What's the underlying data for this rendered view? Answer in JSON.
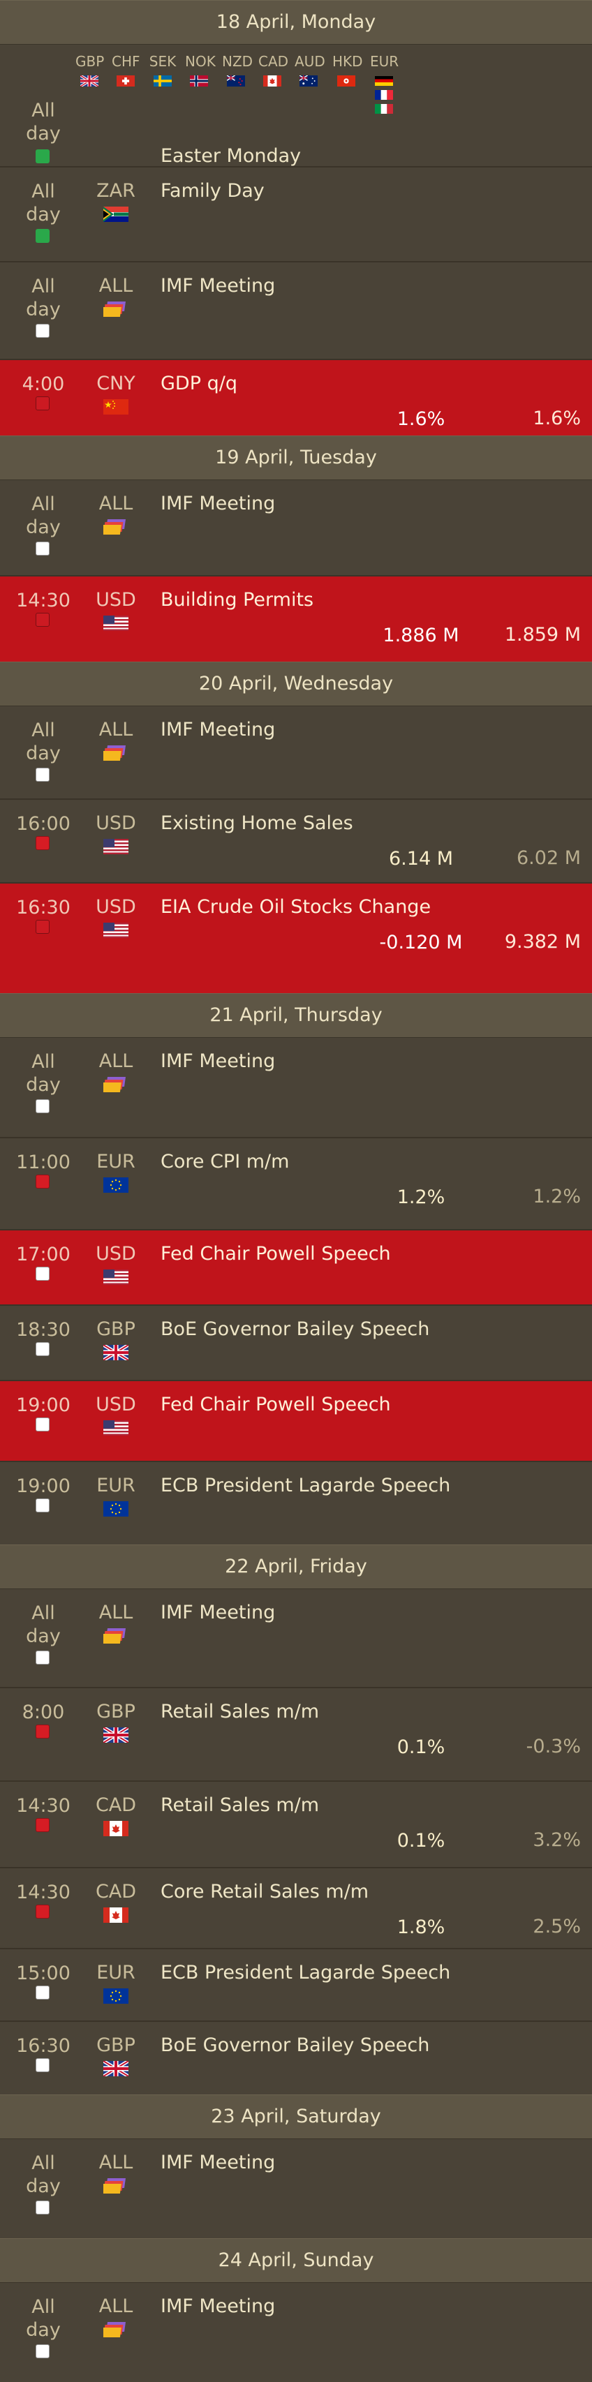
{
  "days": [
    {
      "header": "18 April, Monday",
      "events": [
        {
          "time": "All day",
          "currency": "",
          "title": "Easter Monday",
          "actual": "",
          "forecast": "",
          "red": false,
          "checkbox": "green",
          "multi": true,
          "h": 174,
          "countries": [
            {
              "code": "GBP",
              "flag": "uk"
            },
            {
              "code": "CHF",
              "flag": "ch"
            },
            {
              "code": "SEK",
              "flag": "se"
            },
            {
              "code": "NOK",
              "flag": "no"
            },
            {
              "code": "NZD",
              "flag": "nz"
            },
            {
              "code": "CAD",
              "flag": "ca"
            },
            {
              "code": "AUD",
              "flag": "au"
            },
            {
              "code": "HKD",
              "flag": "hk"
            },
            {
              "code": "EUR",
              "flag": "eu_multi"
            }
          ]
        },
        {
          "time": "All day",
          "currency": "ZAR",
          "flag": "za",
          "title": "Family Day",
          "actual": "",
          "forecast": "",
          "red": false,
          "checkbox": "green",
          "h": 136
        },
        {
          "time": "All day",
          "currency": "ALL",
          "flag": "all",
          "title": "IMF Meeting",
          "actual": "",
          "forecast": "",
          "red": false,
          "checkbox": "empty",
          "h": 140
        },
        {
          "time": "4:00",
          "currency": "CNY",
          "flag": "cn",
          "title": "GDP q/q",
          "actual": "1.6%",
          "forecast": "1.6%",
          "red": true,
          "checkbox": "redbox",
          "h": 110
        }
      ]
    },
    {
      "header": "19 April, Tuesday",
      "events": [
        {
          "time": "All day",
          "currency": "ALL",
          "flag": "all",
          "title": "IMF Meeting",
          "actual": "",
          "forecast": "",
          "red": false,
          "checkbox": "empty",
          "h": 136
        },
        {
          "time": "14:30",
          "currency": "USD",
          "flag": "us",
          "title": "Building Permits",
          "actual": "1.886 M",
          "forecast": "1.859 M",
          "red": true,
          "checkbox": "redbox",
          "h": 124
        }
      ]
    },
    {
      "header": "20 April, Wednesday",
      "events": [
        {
          "time": "All day",
          "currency": "ALL",
          "flag": "all",
          "title": "IMF Meeting",
          "actual": "",
          "forecast": "",
          "red": false,
          "checkbox": "empty",
          "h": 132
        },
        {
          "time": "16:00",
          "currency": "USD",
          "flag": "us",
          "title": "Existing Home Sales",
          "actual": "6.14 M",
          "forecast": "6.02 M",
          "red": false,
          "checkbox": "redbox",
          "h": 120
        },
        {
          "time": "16:30",
          "currency": "USD",
          "flag": "us",
          "title": "EIA Crude Oil Stocks Change",
          "actual": "-0.120 M",
          "forecast": "9.382 M",
          "red": true,
          "checkbox": "redbox",
          "h": 159
        }
      ]
    },
    {
      "header": "21 April, Thursday",
      "events": [
        {
          "time": "All day",
          "currency": "ALL",
          "flag": "all",
          "title": "IMF Meeting",
          "actual": "",
          "forecast": "",
          "red": false,
          "checkbox": "empty",
          "h": 142
        },
        {
          "time": "11:00",
          "currency": "EUR",
          "flag": "eu",
          "title": "Core CPI m/m",
          "actual": "1.2%",
          "forecast": "1.2%",
          "red": false,
          "checkbox": "redbox",
          "h": 132
        },
        {
          "time": "17:00",
          "currency": "USD",
          "flag": "us",
          "title": "Fed Chair Powell Speech",
          "actual": "",
          "forecast": "",
          "red": true,
          "checkbox": "empty",
          "h": 108
        },
        {
          "time": "18:30",
          "currency": "GBP",
          "flag": "uk",
          "title": "BoE Governor Bailey Speech",
          "actual": "",
          "forecast": "",
          "red": false,
          "checkbox": "empty",
          "h": 108
        },
        {
          "time": "19:00",
          "currency": "USD",
          "flag": "us",
          "title": "Fed Chair Powell Speech",
          "actual": "",
          "forecast": "",
          "red": true,
          "checkbox": "empty",
          "h": 116
        },
        {
          "time": "19:00",
          "currency": "EUR",
          "flag": "eu",
          "title": "ECB President Lagarde Speech",
          "actual": "",
          "forecast": "",
          "red": false,
          "checkbox": "empty",
          "h": 120
        }
      ]
    },
    {
      "header": "22 April, Friday",
      "events": [
        {
          "time": "All day",
          "currency": "ALL",
          "flag": "all",
          "title": "IMF Meeting",
          "actual": "",
          "forecast": "",
          "red": false,
          "checkbox": "empty",
          "h": 140
        },
        {
          "time": "8:00",
          "currency": "GBP",
          "flag": "uk",
          "title": "Retail Sales m/m",
          "actual": "0.1%",
          "forecast": "-0.3%",
          "red": false,
          "checkbox": "redbox",
          "h": 134
        },
        {
          "time": "14:30",
          "currency": "CAD",
          "flag": "ca",
          "title": "Retail Sales m/m",
          "actual": "0.1%",
          "forecast": "3.2%",
          "red": false,
          "checkbox": "redbox",
          "h": 124
        },
        {
          "time": "14:30",
          "currency": "CAD",
          "flag": "ca",
          "title": "Core Retail Sales m/m",
          "actual": "1.8%",
          "forecast": "2.5%",
          "red": false,
          "checkbox": "redbox",
          "h": 116
        },
        {
          "time": "15:00",
          "currency": "EUR",
          "flag": "eu",
          "title": "ECB President Lagarde Speech",
          "actual": "",
          "forecast": "",
          "red": false,
          "checkbox": "empty",
          "h": 104
        },
        {
          "time": "16:30",
          "currency": "GBP",
          "flag": "uk",
          "title": "BoE Governor Bailey Speech",
          "actual": "",
          "forecast": "",
          "red": false,
          "checkbox": "empty",
          "h": 106
        }
      ]
    },
    {
      "header": "23 April, Saturday",
      "events": [
        {
          "time": "All day",
          "currency": "ALL",
          "flag": "all",
          "title": "IMF Meeting",
          "actual": "",
          "forecast": "",
          "red": false,
          "checkbox": "empty",
          "h": 142
        }
      ]
    },
    {
      "header": "24 April, Sunday",
      "events": [
        {
          "time": "All day",
          "currency": "ALL",
          "flag": "all",
          "title": "IMF Meeting",
          "actual": "",
          "forecast": "",
          "red": false,
          "checkbox": "empty",
          "h": 142
        }
      ]
    }
  ]
}
